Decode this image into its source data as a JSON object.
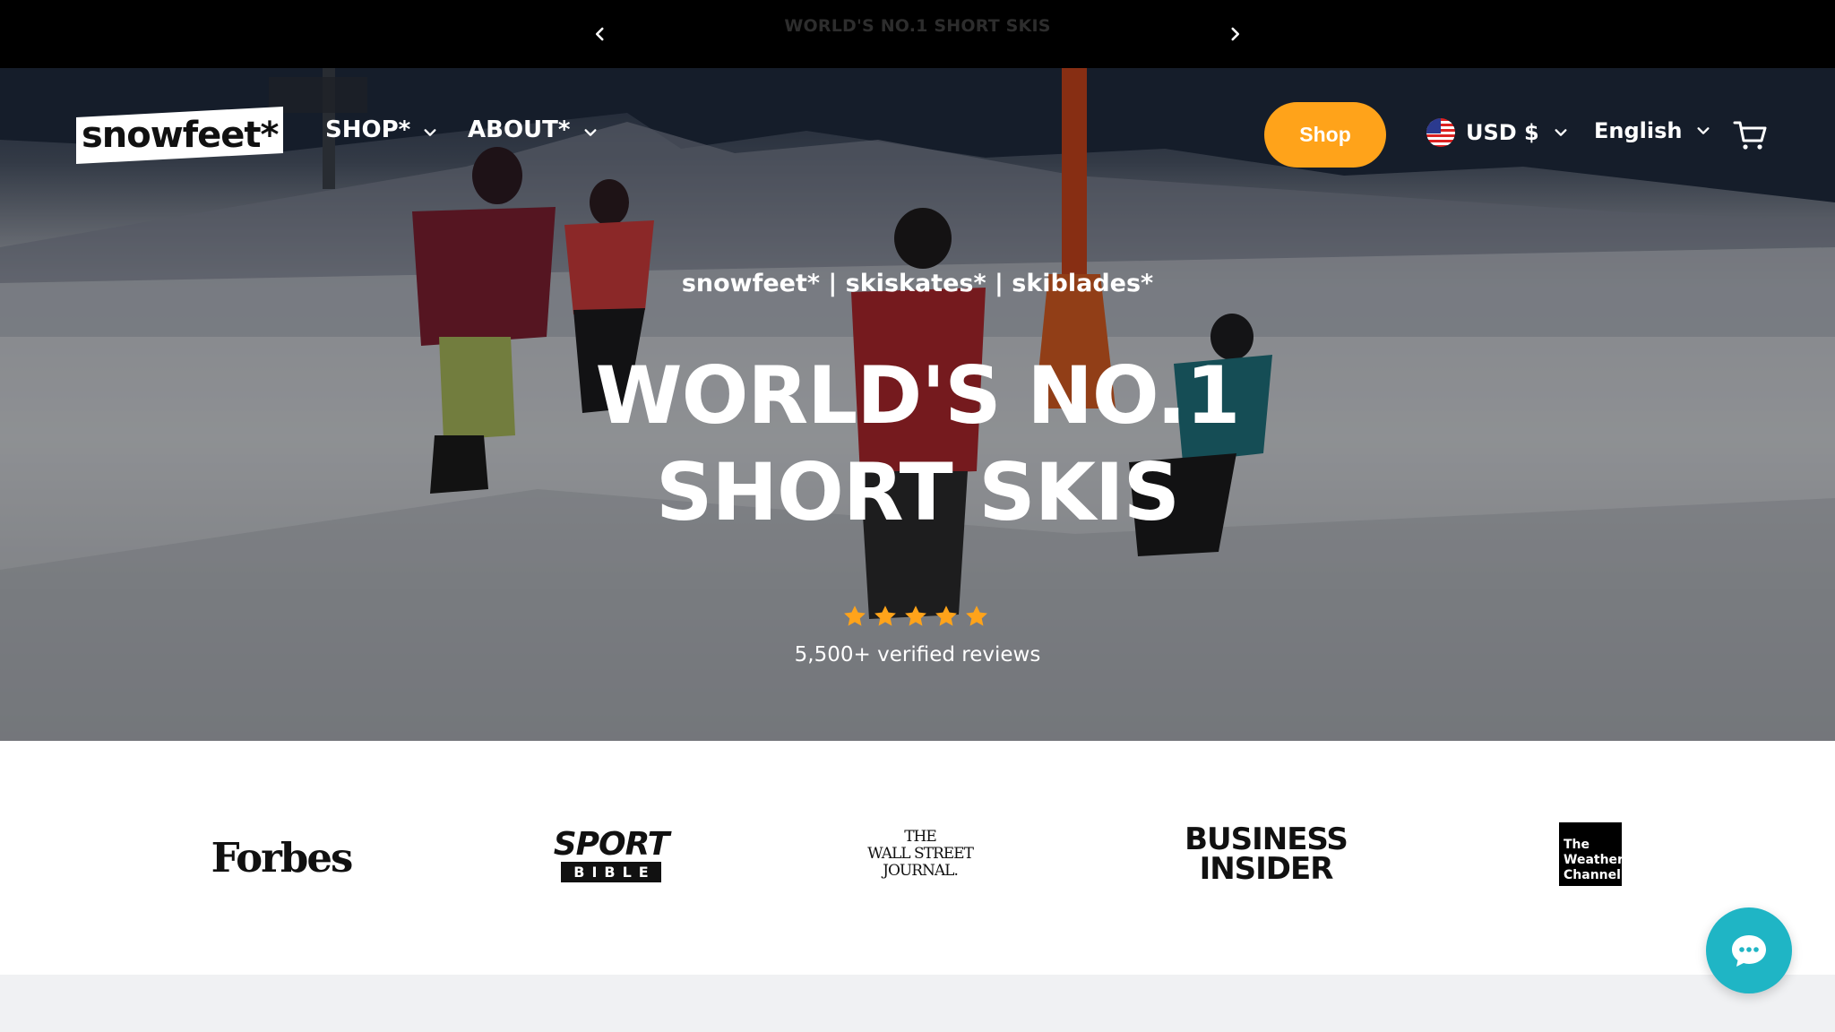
{
  "announcement": {
    "message": "WORLD'S NO.1 SHORT SKIS"
  },
  "header": {
    "logo_text": "snowfeet*",
    "nav": [
      {
        "label": "SHOP*"
      },
      {
        "label": "ABOUT*"
      }
    ],
    "shop_button": "Shop",
    "currency": "USD $",
    "language": "English"
  },
  "hero": {
    "tagline": "snowfeet* | skiskates* | skiblades*",
    "headline_line1": "WORLD'S NO.1",
    "headline_line2": "SHORT SKIS",
    "rating_stars": 5,
    "reviews": "5,500+ verified reviews"
  },
  "press": {
    "forbes": "Forbes",
    "sport_bible_line1": "SPORT",
    "sport_bible_line2": "BIBLE",
    "wsj_line1": "THE",
    "wsj_line2": "WALL STREET",
    "wsj_line3": "JOURNAL.",
    "business_insider_line1": "BUSINESS",
    "business_insider_line2": "INSIDER",
    "weather_line1": "The",
    "weather_line2": "Weather",
    "weather_line3": "Channel"
  },
  "colors": {
    "accent": "#ffa31a",
    "chat": "#1fb5c5",
    "star": "#ffa31a"
  },
  "icons": [
    "chevron-left-icon",
    "chevron-right-icon",
    "chevron-down-icon",
    "us-flag-icon",
    "cart-icon",
    "star-icon",
    "chat-icon"
  ]
}
